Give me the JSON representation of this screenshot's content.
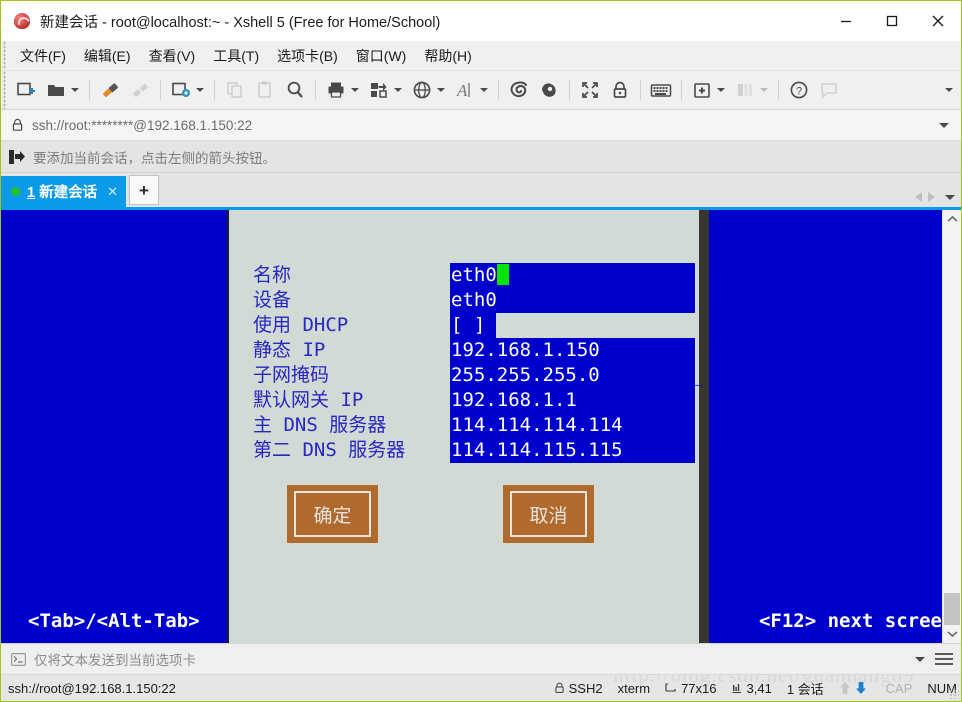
{
  "window": {
    "title": "新建会话 - root@localhost:~ - Xshell 5 (Free for Home/School)",
    "icon": "xshell-app-icon",
    "minimize": "minimize-icon",
    "maximize": "maximize-icon",
    "close": "close-icon"
  },
  "menu": {
    "items": [
      {
        "label": "文件(F)"
      },
      {
        "label": "编辑(E)"
      },
      {
        "label": "查看(V)"
      },
      {
        "label": "工具(T)"
      },
      {
        "label": "选项卡(B)"
      },
      {
        "label": "窗口(W)"
      },
      {
        "label": "帮助(H)"
      }
    ]
  },
  "toolbar": {
    "items": [
      {
        "icon": "new-session-icon",
        "caret": false
      },
      {
        "icon": "open-folder-icon",
        "caret": true
      },
      {
        "sep": true
      },
      {
        "icon": "connect-icon",
        "caret": false
      },
      {
        "icon": "disconnect-icon",
        "caret": false,
        "disabled": true
      },
      {
        "sep": true
      },
      {
        "icon": "session-properties-icon",
        "caret": true
      },
      {
        "sep": true
      },
      {
        "icon": "copy-icon",
        "caret": false,
        "disabled": true
      },
      {
        "icon": "paste-icon",
        "caret": false,
        "disabled": true
      },
      {
        "icon": "find-icon",
        "caret": false
      },
      {
        "sep": true
      },
      {
        "icon": "print-icon",
        "caret": true
      },
      {
        "icon": "transfer-file-icon",
        "caret": true
      },
      {
        "icon": "globe-icon",
        "caret": true
      },
      {
        "icon": "font-icon",
        "caret": true
      },
      {
        "sep": true
      },
      {
        "icon": "xftp-icon",
        "caret": false
      },
      {
        "icon": "xagent-icon",
        "caret": false
      },
      {
        "sep": true
      },
      {
        "icon": "fullscreen-icon",
        "caret": false
      },
      {
        "icon": "lock-icon",
        "caret": false
      },
      {
        "sep": true
      },
      {
        "icon": "keyboard-icon",
        "caret": false
      },
      {
        "sep": true
      },
      {
        "icon": "add-tab-icon",
        "caret": true
      },
      {
        "icon": "arrange-icon",
        "caret": true,
        "disabled": true
      },
      {
        "sep": true
      },
      {
        "icon": "help-icon",
        "caret": false
      },
      {
        "icon": "chat-icon",
        "caret": false,
        "disabled": true
      }
    ],
    "overflow_icon": "toolbar-overflow-icon"
  },
  "address": {
    "lock_icon": "lock-icon",
    "value": "ssh://root:********@192.168.1.150:22",
    "dropdown_icon": "chevron-down-icon"
  },
  "hint": {
    "icon": "add-session-arrow-icon",
    "text": "要添加当前会话，点击左侧的箭头按钮。"
  },
  "tabs": {
    "active": {
      "status_dot": "connected-dot",
      "number": "1",
      "label": "新建会话",
      "close_icon": "close-icon"
    },
    "new_tab_label": "+",
    "nav_prev_icon": "chevron-left-icon",
    "nav_next_icon": "chevron-right-icon",
    "nav_list_icon": "chevron-down-icon"
  },
  "terminal": {
    "dialog": {
      "fields": [
        {
          "label": "名称",
          "value": "eth0",
          "underscores": "",
          "cursor": true,
          "checkbox": false
        },
        {
          "label": "设备",
          "value": "eth0",
          "underscores": "_",
          "cursor": false,
          "checkbox": false
        },
        {
          "label": "使用 DHCP",
          "value": "[ ]",
          "underscores": "",
          "cursor": false,
          "checkbox": true
        },
        {
          "label": "静态 IP",
          "value": "192.168.1.150",
          "underscores": "________",
          "cursor": false,
          "checkbox": false
        },
        {
          "label": "子网掩码",
          "value": "255.255.255.0",
          "underscores": "_________",
          "cursor": false,
          "checkbox": false
        },
        {
          "label": "默认网关 IP",
          "value": "192.168.1.1",
          "underscores": "__________",
          "cursor": false,
          "checkbox": false
        },
        {
          "label": "主 DNS 服务器",
          "value": "114.114.114.114",
          "underscores": "_____",
          "cursor": false,
          "checkbox": false
        },
        {
          "label": "第二 DNS 服务器",
          "value": "114.114.115.115",
          "underscores": "_____",
          "cursor": false,
          "checkbox": false
        }
      ],
      "ok_button": "确定",
      "cancel_button": "取消"
    },
    "bottom_hint_left": "<Tab>/<Alt-Tab>",
    "bottom_hint_right": "<F12> next scree",
    "colors": {
      "background": "#0000cc",
      "dialog_bg": "#d2dad5",
      "label_fg": "#2727c4",
      "button_bg": "#b06a2d",
      "cursor": "#00e400",
      "shadow": "#38372f"
    }
  },
  "scrollbar": {
    "up_icon": "chevron-up-icon",
    "down_icon": "chevron-down-icon"
  },
  "sendbar": {
    "icon": "terminal-prompt-icon",
    "text": "仅将文本发送到当前选项卡",
    "caret_icon": "chevron-down-icon",
    "menu_icon": "hamburger-icon"
  },
  "statusbar": {
    "connection": "ssh://root@192.168.1.150:22",
    "protocol_icon": "lock-icon",
    "protocol": "SSH2",
    "emulation": "xterm",
    "size_icon": "screen-size-icon",
    "size": "77x16",
    "cursor_icon": "cursor-pos-icon",
    "cursor_pos": "3,41",
    "sessions": "1 会话",
    "upload_icon": "upload-arrow-icon",
    "download_icon": "download-arrow-icon",
    "cap": "CAP",
    "num": "NUM",
    "watermark": "http://blog.csdn.net/guanhang89"
  }
}
